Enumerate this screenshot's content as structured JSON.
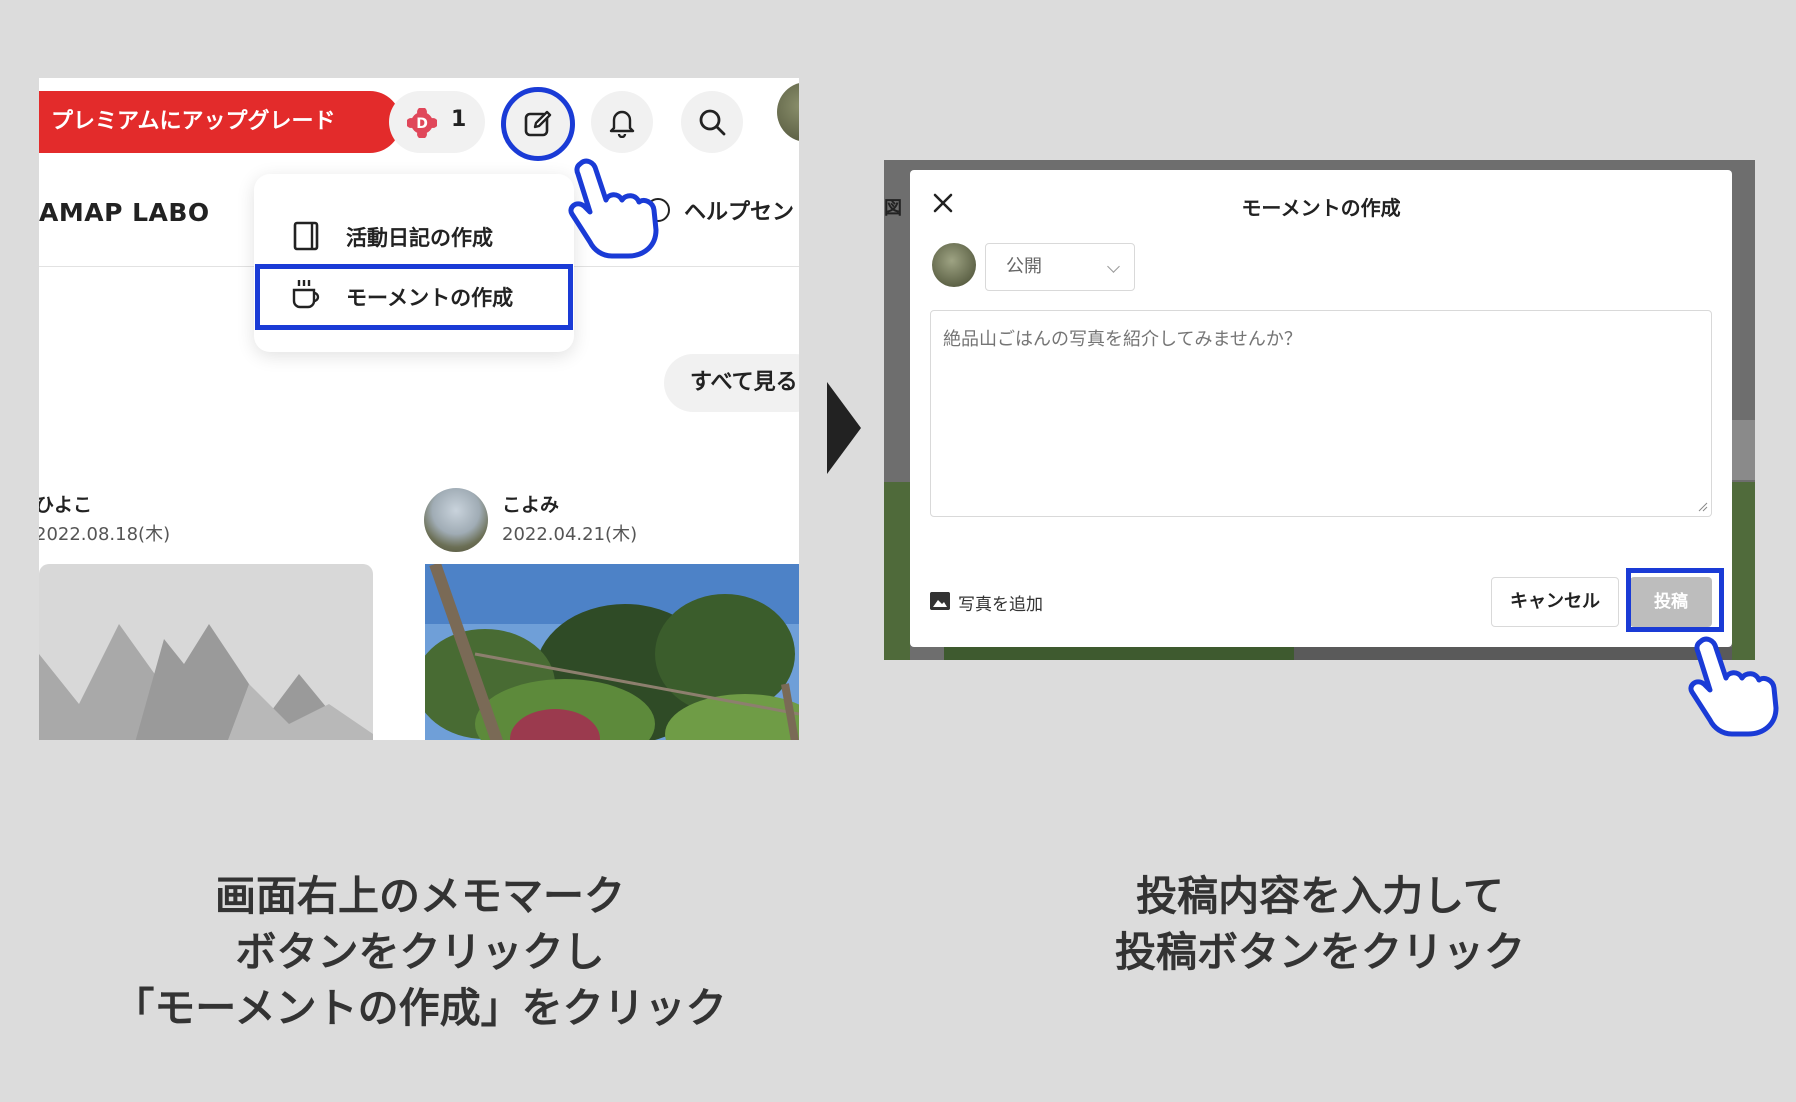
{
  "left": {
    "upgrade_label": "プレミアムにアップグレード",
    "dpoint_count": "1",
    "logo": "AMAP LABO",
    "help_label": "ヘルプセン",
    "menu": {
      "item1": "活動日記の作成",
      "item2": "モーメントの作成"
    },
    "see_all": "すべて見る",
    "users": [
      {
        "name": "ひよこ",
        "date": "2022.08.18(木)"
      },
      {
        "name": "こよみ",
        "date": "2022.04.21(木)"
      }
    ]
  },
  "right": {
    "side_label": "図",
    "modal_title": "モーメントの作成",
    "visibility": "公開",
    "textarea_placeholder": "絶品山ごはんの写真を紹介してみませんか？",
    "add_photo": "写真を追加",
    "cancel": "キャンセル",
    "post": "投稿"
  },
  "captions": {
    "left": [
      "画面右上のメモマーク",
      "ボタンをクリックし",
      "「モーメントの作成」をクリック"
    ],
    "right": [
      "投稿内容を入力して",
      "投稿ボタンをクリック"
    ]
  },
  "colors": {
    "highlight": "#1a3bd6",
    "upgrade": "#e32b2b",
    "background": "#dcdcdc"
  }
}
